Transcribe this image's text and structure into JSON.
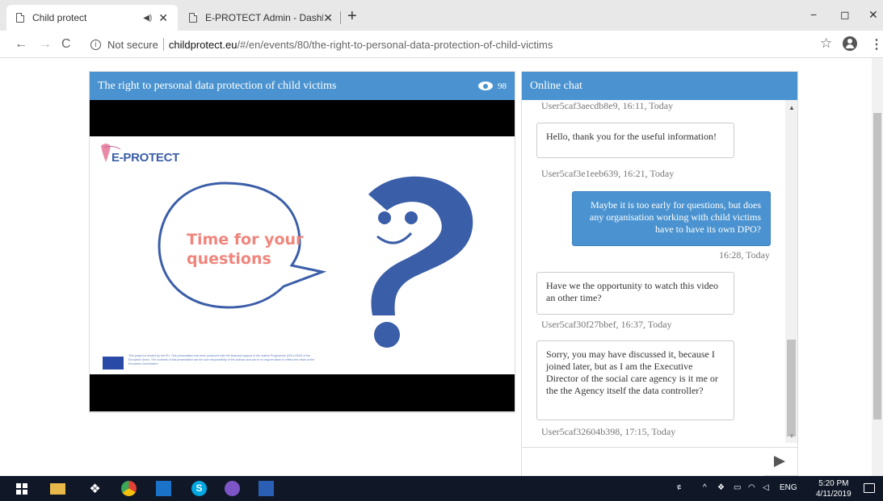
{
  "browser": {
    "tabs": [
      {
        "title": "Child protect",
        "active": true
      },
      {
        "title": "E-PROTECT Admin - Dashboard",
        "active": false
      }
    ],
    "new_tab_label": "+",
    "window_controls": {
      "minimize": "−",
      "restore": "◻",
      "close": "✕"
    },
    "address": {
      "security_label": "Not secure",
      "host": "childprotect.eu",
      "path": "/#/en/events/80/the-right-to-personal-data-protection-of-child-victims"
    }
  },
  "video": {
    "title": "The right to personal data protection of child victims",
    "views": "98",
    "slide": {
      "logo_text": "E-PROTECT",
      "question_line1": "Time for your",
      "question_line2": "questions",
      "funding_text": "This project is funded by the EU. This presentation has been produced with the financial support of the Justice Programme (2014-2020) of the European Union. The contents of this presentation are the sole responsibility of the authors and can in no way be taken to reflect the views of the European Commission."
    }
  },
  "chat": {
    "title": "Online chat",
    "messages": [
      {
        "user": "User5caf3aecdb8e9",
        "time": "16:11, Today",
        "text": ""
      },
      {
        "user": "User5caf3e1eeb639",
        "time": "16:21, Today",
        "text": "Hello, thank you for the useful information!"
      },
      {
        "user": "",
        "time": "16:28, Today",
        "text": "Maybe it is too early for questions, but does any organisation working with child victims have to have its own DPO?",
        "mine": true
      },
      {
        "user": "User5caf30f27bbef",
        "time": "16:37, Today",
        "text": "Have we the opportunity to watch this video an other time?"
      },
      {
        "user": "User5caf32604b398",
        "time": "17:15, Today",
        "text": "Sorry, you may have discussed it, because I joined later, but as I am the Executive Director of the social care agency is it me or the the Agency itself the data controller?"
      }
    ],
    "input_placeholder": ""
  },
  "taskbar": {
    "language": "ENG",
    "time": "5:20 PM",
    "date": "4/11/2019"
  },
  "colors": {
    "header_blue": "#4a93d0",
    "slide_pink": "#f0857c",
    "slide_blue": "#3b5ea8",
    "taskbar": "#101828"
  }
}
